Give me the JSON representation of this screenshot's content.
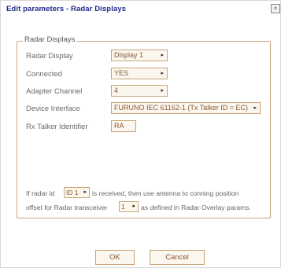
{
  "window": {
    "title": "Edit parameters - Radar Displays",
    "close_glyph": "×"
  },
  "group": {
    "legend": "Radar Displays"
  },
  "rows": [
    {
      "label": "Radar Display",
      "value": "Display 1"
    },
    {
      "label": "Connected",
      "value": "YES"
    },
    {
      "label": "Adapter Channel",
      "value": "4"
    },
    {
      "label": "Device Interface",
      "value": "FURUNO IEC 61162-1 (Tx Talker ID = EC)"
    },
    {
      "label": "Rx Talker Identifier",
      "value": "RA"
    }
  ],
  "footer_text": {
    "line1_a": "If radar id",
    "radar_id": "ID 1",
    "line1_b": "is received, then use antenna to conning position",
    "line2_a": "offset for Radar transceiver",
    "transceiver": "1",
    "line2_b": "as defined in Radar Overlay params."
  },
  "buttons": {
    "ok": "OK",
    "cancel": "Cancel"
  },
  "icons": {
    "dropdown": "caret-right-icon",
    "close": "close-icon"
  },
  "colors": {
    "title": "#1f2a8a",
    "border": "#c9a47a",
    "field_text": "#8a5a36"
  }
}
